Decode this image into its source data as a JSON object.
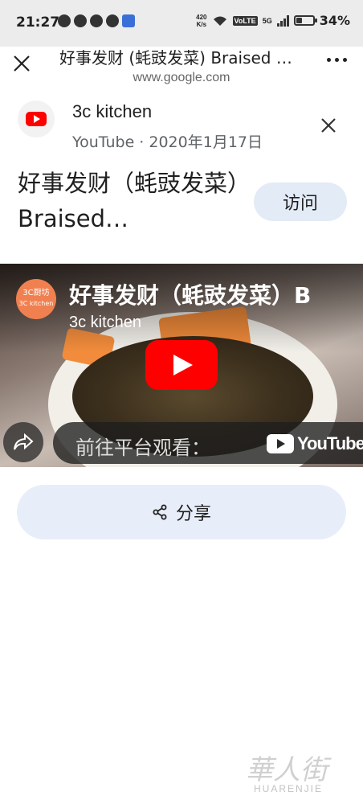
{
  "status_bar": {
    "time": "21:27",
    "net_speed_value": "420",
    "net_speed_unit": "K/s",
    "volte": "VoLTE",
    "network": "5G",
    "battery_percent": "34%",
    "battery_level": 0.34
  },
  "browser": {
    "title": "好事发财 (蚝豉发菜) Braised Dried Oysters",
    "url": "www.google.com"
  },
  "card": {
    "channel_name": "3c kitchen",
    "channel_meta": "YouTube · 2020年1月17日",
    "video_title": "好事发财（蚝豉发菜）Braised…",
    "visit_label": "访问"
  },
  "video": {
    "overlay_title": "好事发财（蚝豉发菜）B",
    "overlay_channel": "3c kitchen",
    "avatar_line1": "3C厨坊",
    "avatar_line2": "3C kitchen",
    "watch_text": "前往平台观看：",
    "yt_logo_text": "YouTube"
  },
  "actions": {
    "share_label": "分享"
  },
  "watermark": {
    "cn": "華人街",
    "en": "HUARENJIE"
  },
  "colors": {
    "accent_red": "#ff0000",
    "button_bg": "#e3ebf6",
    "share_bg": "#e8eef9"
  }
}
